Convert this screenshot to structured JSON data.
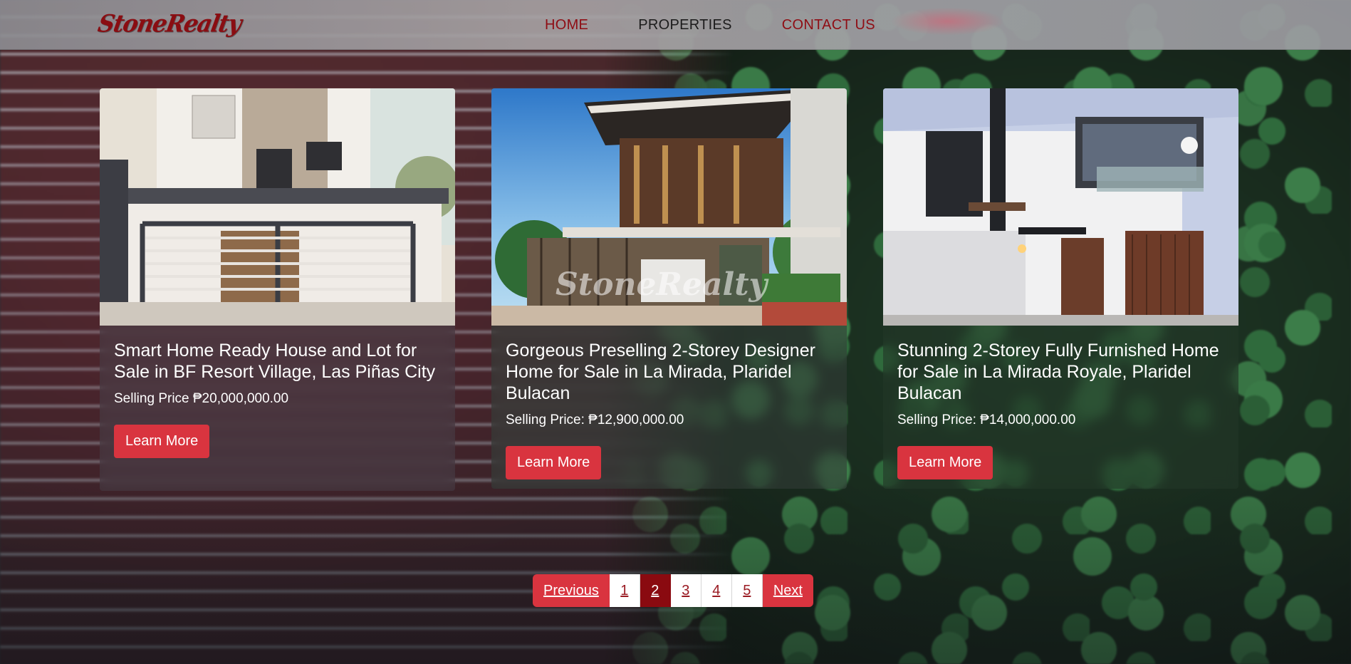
{
  "brand": {
    "logo_text": "StoneRealty"
  },
  "nav": {
    "home": "HOME",
    "properties": "PROPERTIES",
    "contact": "CONTACT US"
  },
  "colors": {
    "accent": "#d9343f",
    "brand_dark_red": "#8a0d12",
    "current_page": "#8a0a10"
  },
  "listings": [
    {
      "title": "Smart Home Ready House and Lot for Sale in BF Resort Village, Las Piñas City",
      "price": "Selling Price ₱20,000,000.00",
      "button": "Learn More"
    },
    {
      "title": "Gorgeous Preselling 2-Storey Designer Home for Sale in La Mirada, Plaridel Bulacan",
      "price": "Selling Price: ₱12,900,000.00",
      "button": "Learn More",
      "watermark": "StoneRealty"
    },
    {
      "title": "Stunning 2-Storey Fully Furnished Home for Sale in La Mirada Royale, Plaridel Bulacan",
      "price": "Selling Price: ₱14,000,000.00",
      "button": "Learn More"
    }
  ],
  "pagination": {
    "previous": "Previous",
    "next": "Next",
    "pages": [
      "1",
      "2",
      "3",
      "4",
      "5"
    ],
    "current": "2"
  }
}
